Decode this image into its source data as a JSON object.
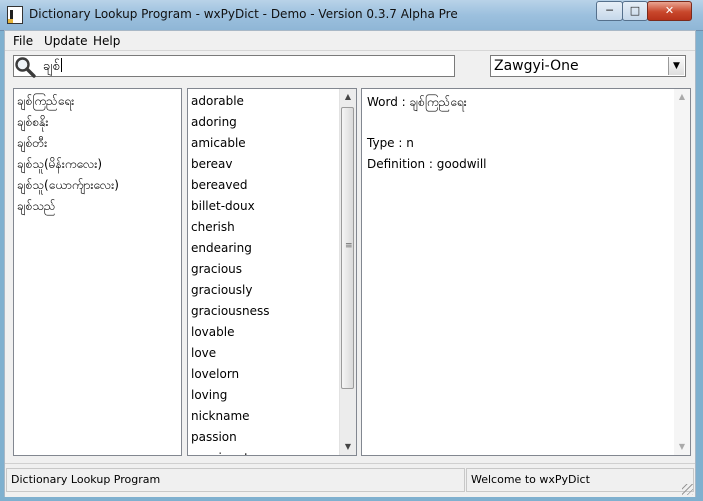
{
  "window": {
    "title": "Dictionary Lookup Program - wxPyDict - Demo - Version 0.3.7 Alpha Pre",
    "controls": {
      "minimize": "─",
      "maximize": "□",
      "close": "✕"
    }
  },
  "menu": {
    "file": "File",
    "update": "Update",
    "help": "Help"
  },
  "search": {
    "value": "ချစ်",
    "icon": "magnifier-icon"
  },
  "font_select": {
    "selected": "Zawgyi-One",
    "arrow": "▼"
  },
  "words_pane": {
    "items": [
      "ချစ်ကြည်ရေး",
      "ချစ်စနိုး",
      "ချစ်တီး",
      "ချစ်သူ(မိန်းကလေး)",
      "ချစ်သူ(ယောက်ျားလေး)",
      "ချစ်သည်"
    ]
  },
  "english_pane": {
    "items": [
      "adorable",
      "adoring",
      "amicable",
      "bereav",
      "bereaved",
      "billet-doux",
      "cherish",
      "endearing",
      "gracious",
      "graciously",
      "graciousness",
      "lovable",
      "love",
      "lovelorn",
      "loving",
      "nickname",
      "passion",
      "passionate"
    ]
  },
  "detail": {
    "word": "Word : ချစ်ကြည်ရေး",
    "type": "Type : n",
    "definition": "Definition : goodwill"
  },
  "statusbar": {
    "left": "Dictionary Lookup Program",
    "right": "Welcome to wxPyDict"
  },
  "scrollbar": {
    "up": "▲",
    "down": "▼",
    "grip": "≡"
  }
}
